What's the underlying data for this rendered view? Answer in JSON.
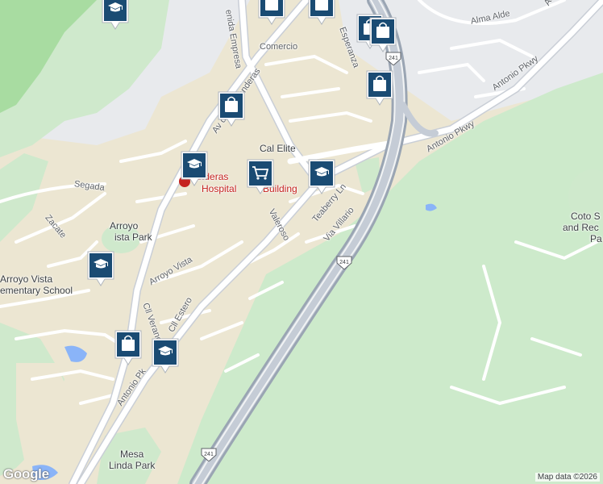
{
  "map": {
    "streets": {
      "alma_aldea": "Alma Alde",
      "antonio_pkwy_ne": "Antonio Pkwy",
      "antonio_pkwy_ne2": "Antonio Pkwy",
      "antonio_pkwy_ne3": "Antonio Pkwy",
      "antonio_pkwy_sw": "Antonio Pk",
      "avenida_empresa": "enida Empresa",
      "comercio": "Comercio",
      "esperanza": "Esperanza",
      "av_banderas": "Av    de las Banderas",
      "cal_elite": "Cal Elite",
      "segada": "Segada",
      "zacate": "Zacate",
      "valeroso": "Valeroso",
      "teaberry": "Teaberry Ln",
      "via_villario": "Via Villario",
      "arroyo_vista": "Arroyo Vista",
      "cll_estero": "Cll Estero",
      "cll_verano": "Cll Verano"
    },
    "places": {
      "hospital_line1": "anderas",
      "hospital_line2": "Hospital",
      "hospital_suffix": "Building",
      "arroyo_park_line1": "Arroyo",
      "arroyo_park_line2": "ista Park",
      "arroyo_school_line1": "Arroyo Vista",
      "arroyo_school_line2": "ementary School",
      "mesa_linda_line1": "Mesa",
      "mesa_linda_line2": "Linda Park",
      "coto_line1": "Coto S",
      "coto_line2": "and Rec",
      "coto_line3": "Pa"
    },
    "route_shield": "241",
    "pins": [
      {
        "type": "school"
      },
      {
        "type": "shopping"
      },
      {
        "type": "shopping"
      },
      {
        "type": "shopping"
      },
      {
        "type": "shopping"
      },
      {
        "type": "shopping"
      },
      {
        "type": "shopping"
      },
      {
        "type": "school"
      },
      {
        "type": "cart"
      },
      {
        "type": "school"
      },
      {
        "type": "school"
      },
      {
        "type": "shopping"
      },
      {
        "type": "school"
      }
    ],
    "attribution": "Map data ©2026",
    "logo": "Google",
    "colors": {
      "land": "#e8eaed",
      "green": "#cdeacb",
      "sand": "#ece6d2",
      "forest": "#8fcf8a",
      "water": "#8ab4f8",
      "road": "#ffffff",
      "highway": "#9aa5b3",
      "pin": "#1a4b73"
    }
  }
}
